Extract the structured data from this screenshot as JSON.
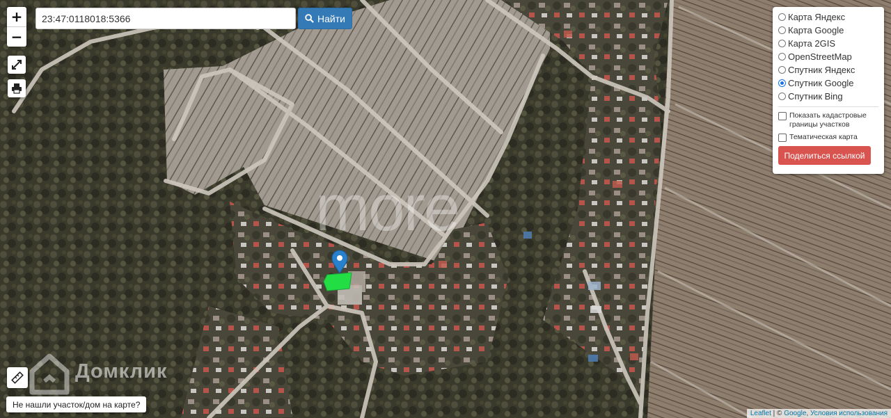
{
  "map": {
    "imagery": "satellite",
    "marker_icon": "map-pin-icon",
    "parcel_color": "#22dd44"
  },
  "zoom": {
    "in_label": "+",
    "out_label": "−"
  },
  "controls": {
    "fullscreen_icon": "expand-icon",
    "print_icon": "print-icon",
    "ruler_icon": "ruler-icon"
  },
  "search": {
    "value": "23:47:0118018:5366",
    "button_label": "Найти",
    "button_icon": "search-icon"
  },
  "layers": {
    "options": [
      {
        "label": "Карта Яндекс",
        "selected": false
      },
      {
        "label": "Карта Google",
        "selected": false
      },
      {
        "label": "Карта 2GIS",
        "selected": false
      },
      {
        "label": "OpenStreetMap",
        "selected": false
      },
      {
        "label": "Спутник Яндекс",
        "selected": false
      },
      {
        "label": "Спутник Google",
        "selected": true
      },
      {
        "label": "Спутник Bing",
        "selected": false
      }
    ],
    "cadastral_label": "Показать кадастровые границы участков",
    "thematic_label": "Тематическая карта",
    "share_label": "Поделиться ссылкой"
  },
  "watermark": {
    "text": "more"
  },
  "brand": {
    "name": "Домклик"
  },
  "not_found_label": "Не нашли участок/дом на карте?",
  "attribution": {
    "leaflet": "Leaflet",
    "separator": " | © ",
    "google": "Google",
    "terms": "Условия использования"
  },
  "colors": {
    "primary": "#337ab7",
    "danger": "#d9534f",
    "radio_selected": "#1a73e8"
  }
}
